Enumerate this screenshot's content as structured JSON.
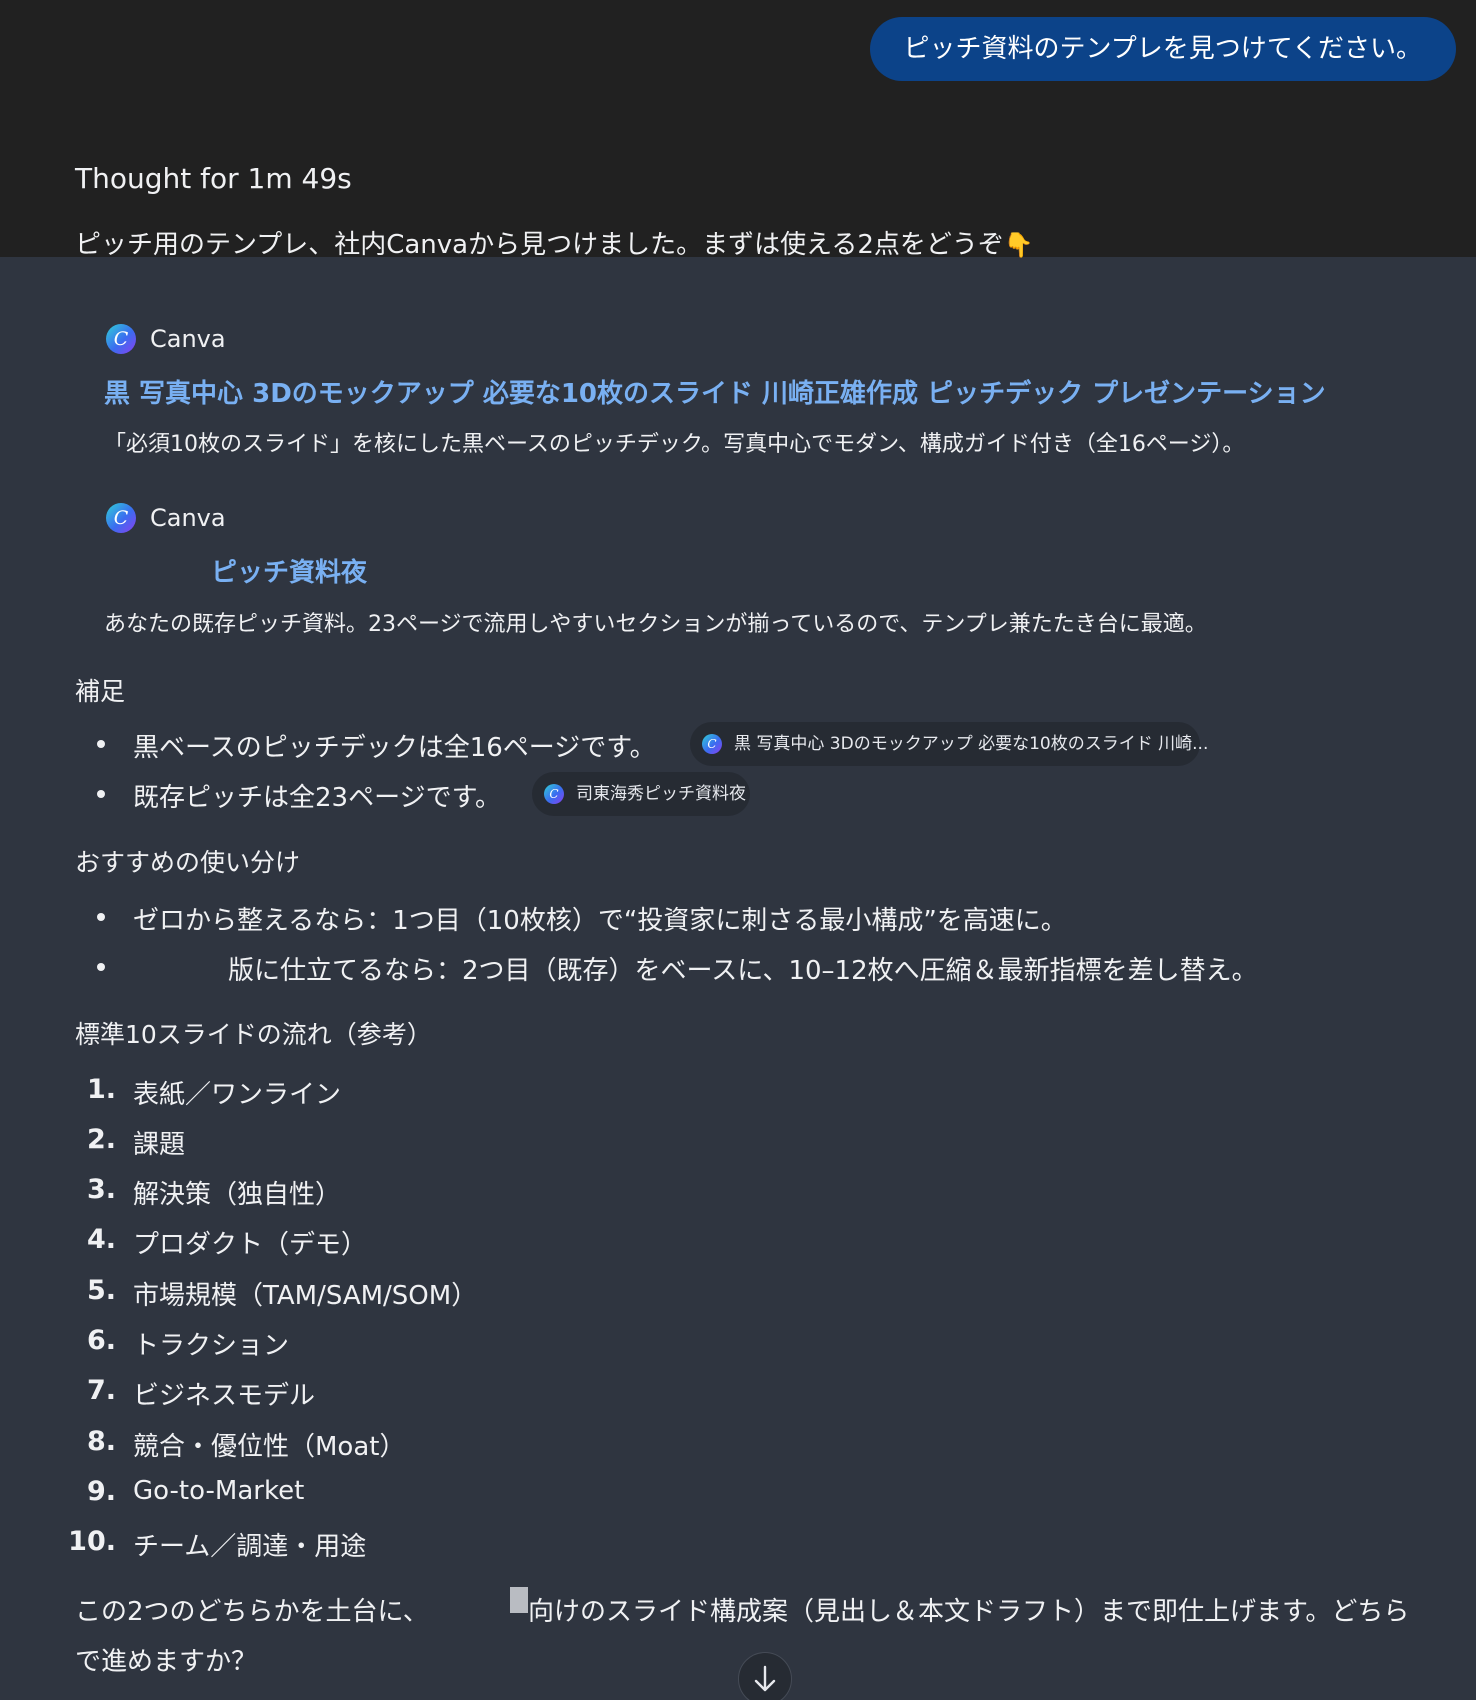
{
  "user_message": "ピッチ資料のテンプレを見つけてください。",
  "thought_label": "Thought for 1m 49s",
  "intro": {
    "text": "ピッチ用のテンプレ、社内Canvaから見つけました。まずは使える2点をどうぞ",
    "emoji": "👇"
  },
  "results": [
    {
      "source": "Canva",
      "title": "黒 写真中心 3Dのモックアップ 必要な10枚のスライド 川崎正雄作成 ピッチデック プレゼンテーション",
      "description": "「必須10枚のスライド」を核にした黒ベースのピッチデック。写真中心でモダン、構成ガイド付き（全16ページ）。"
    },
    {
      "source": "Canva",
      "title": "ピッチ資料夜",
      "description": "あなたの既存ピッチ資料。23ページで流用しやすいセクションが揃っているので、テンプレ兼たたき台に最適。"
    }
  ],
  "supplement": {
    "heading": "補足",
    "items": [
      {
        "text": "黒ベースのピッチデックは全16ページです。",
        "chip": "黒 写真中心 3Dのモックアップ 必要な10枚のスライド 川崎..."
      },
      {
        "text": "既存ピッチは全23ページです。",
        "chip": "司東海秀ピッチ資料夜"
      }
    ]
  },
  "recommend": {
    "heading": "おすすめの使い分け",
    "items": [
      "ゼロから整えるなら：1つ目（10枚核）で“投資家に刺さる最小構成”を高速に。",
      "版に仕立てるなら：2つ目（既存）をベースに、10–12枚へ圧縮＆最新指標を差し替え。"
    ]
  },
  "standard": {
    "heading": "標準10スライドの流れ（参考）",
    "items": [
      {
        "num": "1.",
        "text": "表紙／ワンライン"
      },
      {
        "num": "2.",
        "text": "課題"
      },
      {
        "num": "3.",
        "text": "解決策（独自性）"
      },
      {
        "num": "4.",
        "text": "プロダクト（デモ）"
      },
      {
        "num": "5.",
        "text": "市場規模（TAM/SAM/SOM）"
      },
      {
        "num": "6.",
        "text": "トラクション"
      },
      {
        "num": "7.",
        "text": "ビジネスモデル"
      },
      {
        "num": "8.",
        "text": "競合・優位性（Moat）"
      },
      {
        "num": "9.",
        "text": "Go-to-Market"
      },
      {
        "num": "10.",
        "text": "チーム／調達・用途"
      }
    ]
  },
  "footer": {
    "line1_start": "この2つのどちらかを土台に、",
    "line1_end": "向けのスライド構成案（見出し＆本文ドラフト）まで即仕上げます。どちら",
    "line2": "で進めますか？"
  },
  "icons": {
    "canva": "canva-icon",
    "scroll": "arrow-down-icon"
  }
}
